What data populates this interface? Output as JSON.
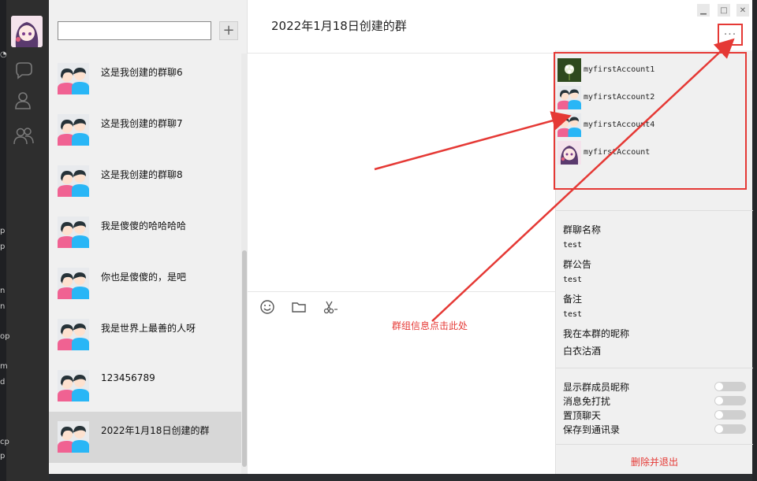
{
  "chat_list": {
    "items": [
      {
        "name": "这是我创建的群聊6"
      },
      {
        "name": "这是我创建的群聊7"
      },
      {
        "name": "这是我创建的群聊8"
      },
      {
        "name": "我是傻傻的哈哈哈哈"
      },
      {
        "name": "你也是傻傻的，是吧"
      },
      {
        "name": "我是世界上最善的人呀"
      },
      {
        "name": "123456789"
      },
      {
        "name": "2022年1月18日创建的群"
      }
    ],
    "selected_index": 7,
    "add_label": "+"
  },
  "chat": {
    "title": "2022年1月18日创建的群",
    "more_label": "···"
  },
  "members": [
    {
      "name": "myfirstAccount1",
      "avatar": "flower"
    },
    {
      "name": "myfirstAccount2",
      "avatar": "couple"
    },
    {
      "name": "myfirstAccount4",
      "avatar": "couple"
    },
    {
      "name": "myfirstAccount",
      "avatar": "anime"
    }
  ],
  "group_info": {
    "name_label": "群聊名称",
    "name_value": "test",
    "notice_label": "群公告",
    "notice_value": "test",
    "remark_label": "备注",
    "remark_value": "test",
    "nickname_label": "我在本群的昵称",
    "nickname_value": "白衣沽酒"
  },
  "toggles": [
    {
      "label": "显示群成员昵称",
      "on": false
    },
    {
      "label": "消息免打扰",
      "on": false
    },
    {
      "label": "置顶聊天",
      "on": false
    },
    {
      "label": "保存到通讯录",
      "on": false
    }
  ],
  "exit_label": "删除并退出",
  "annotation": "群组信息点击此处",
  "edge_chars": [
    "p",
    "p",
    "n",
    "n",
    "op",
    "m",
    "d",
    "cp",
    "p"
  ],
  "colors": {
    "accent": "#e53935",
    "selected": "#d7d7d7",
    "panel": "#f0f0f0"
  }
}
